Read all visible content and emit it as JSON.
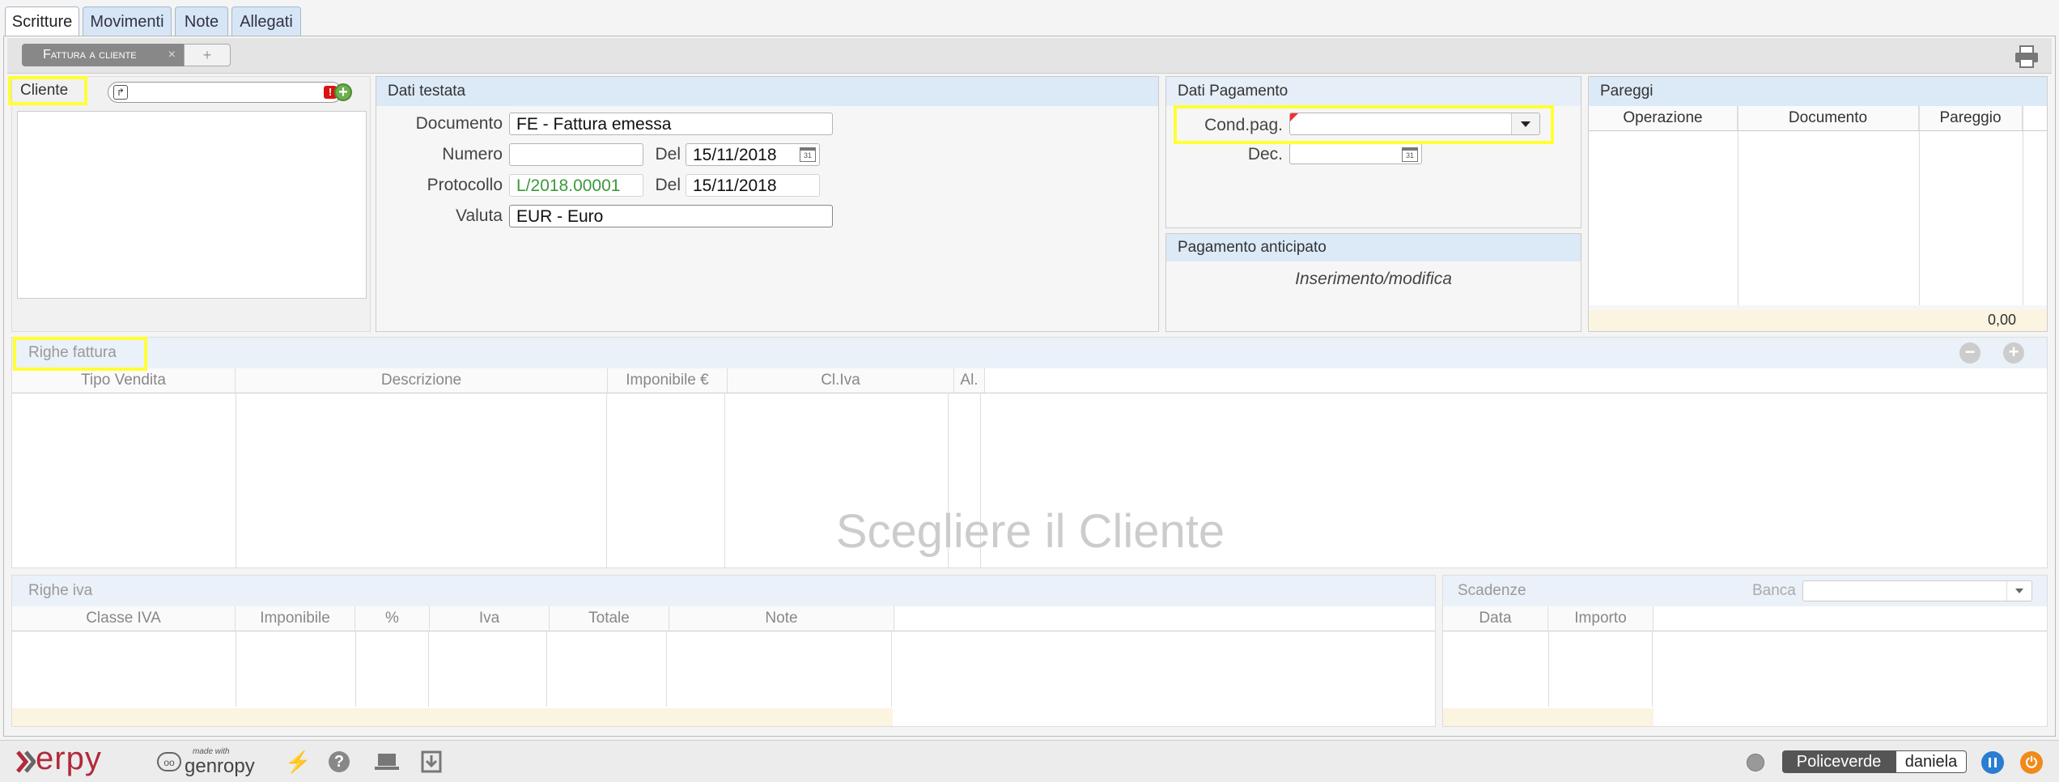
{
  "tabs": [
    "Scritture",
    "Movimenti",
    "Note",
    "Allegati"
  ],
  "subtabs": {
    "active": "Fattura a cliente",
    "add": "+"
  },
  "cliente": {
    "label": "Cliente"
  },
  "dati_testata": {
    "title": "Dati testata",
    "documento_label": "Documento",
    "documento_value": "FE - Fattura emessa",
    "numero_label": "Numero",
    "numero_value": "",
    "del_label": "Del",
    "del_value": "15/11/2018",
    "protocollo_label": "Protocollo",
    "protocollo_value": "L/2018.00001",
    "del2_label": "Del",
    "del2_value": "15/11/2018",
    "valuta_label": "Valuta",
    "valuta_value": "EUR - Euro"
  },
  "dati_pagamento": {
    "title": "Dati Pagamento",
    "cond_label": "Cond.pag.",
    "dec_label": "Dec."
  },
  "pagamento_anticipato": {
    "title": "Pagamento anticipato",
    "text": "Inserimento/modifica"
  },
  "pareggi": {
    "title": "Pareggi",
    "columns": [
      "Operazione",
      "Documento",
      "Pareggio"
    ],
    "total": "0,00"
  },
  "righe_fattura": {
    "title": "Righe fattura",
    "columns": [
      "Tipo Vendita",
      "Descrizione",
      "Imponibile €",
      "Cl.Iva",
      "Al."
    ],
    "empty_msg": "Scegliere il Cliente"
  },
  "righe_iva": {
    "title": "Righe iva",
    "columns": [
      "Classe IVA",
      "Imponibile",
      "%",
      "Iva",
      "Totale",
      "Note"
    ]
  },
  "scadenze": {
    "title": "Scadenze",
    "banca_label": "Banca",
    "columns": [
      "Data",
      "Importo"
    ]
  },
  "statusbar": {
    "logo": "erpy",
    "made_with": "made with",
    "genropy": "genropy",
    "company": "Policeverde",
    "user": "daniela"
  },
  "colors": {
    "highlight": "#ffff33",
    "tab_bg": "#d6e6f7",
    "panel_title_bg": "#dce9f7",
    "logo_red": "#b22a3a"
  }
}
